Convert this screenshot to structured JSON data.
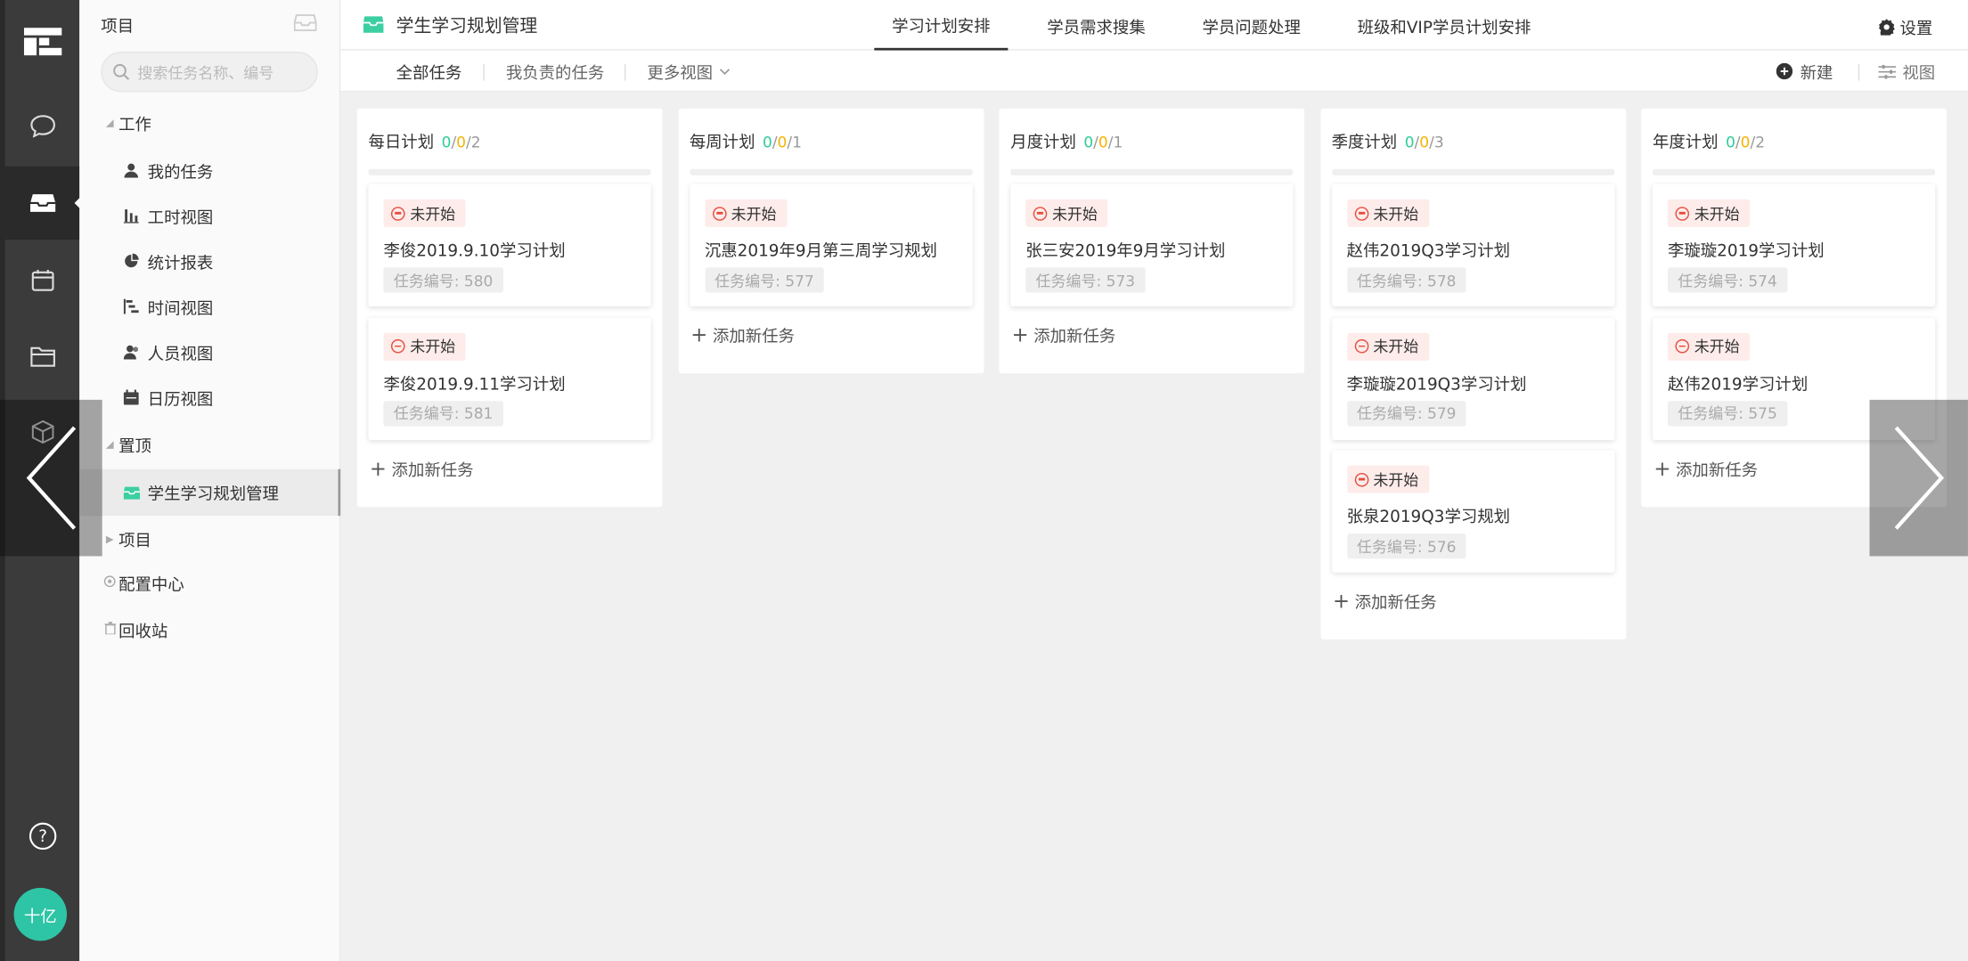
{
  "rail": {
    "avatar_label": "十亿",
    "items": [
      "dashboard-icon",
      "chat-icon",
      "inbox-icon",
      "calendar-icon",
      "folder-icon",
      "cube-icon"
    ],
    "help_icon": "question-circle-icon"
  },
  "sidebar": {
    "title": "项目",
    "search_placeholder": "搜索任务名称、编号",
    "groups": {
      "work": "工作",
      "pinned": "置顶",
      "projects": "项目"
    },
    "work_items": [
      {
        "label": "我的任务",
        "icon": "user-icon"
      },
      {
        "label": "工时视图",
        "icon": "bar-chart-icon"
      },
      {
        "label": "统计报表",
        "icon": "pie-chart-icon"
      },
      {
        "label": "时间视图",
        "icon": "gantt-icon"
      },
      {
        "label": "人员视图",
        "icon": "team-icon"
      },
      {
        "label": "日历视图",
        "icon": "calendar-icon"
      }
    ],
    "pinned_item": "学生学习规划管理",
    "config": "配置中心",
    "recycle": "回收站"
  },
  "header": {
    "project_name": "学生学习规划管理",
    "tabs": [
      "学习计划安排",
      "学员需求搜集",
      "学员问题处理",
      "班级和VIP学员计划安排"
    ],
    "active_tab": 0,
    "settings": "设置"
  },
  "subbar": {
    "tabs": [
      "全部任务",
      "我负责的任务",
      "更多视图"
    ],
    "new": "新建",
    "view": "视图"
  },
  "board": {
    "add_task": "添加新任务",
    "status_label": "未开始",
    "id_prefix": "任务编号: ",
    "columns": [
      {
        "name": "每日计划",
        "done": "0",
        "doing": "0",
        "total": "2",
        "cards": [
          {
            "title": "李俊2019.9.10学习计划",
            "id": "任务编号: 580"
          },
          {
            "title": "李俊2019.9.11学习计划",
            "id": "任务编号: 581"
          }
        ]
      },
      {
        "name": "每周计划",
        "done": "0",
        "doing": "0",
        "total": "1",
        "cards": [
          {
            "title": "沉惠2019年9月第三周学习规划",
            "id": "任务编号: 577"
          }
        ]
      },
      {
        "name": "月度计划",
        "done": "0",
        "doing": "0",
        "total": "1",
        "cards": [
          {
            "title": "张三安2019年9月学习计划",
            "id": "任务编号: 573"
          }
        ]
      },
      {
        "name": "季度计划",
        "done": "0",
        "doing": "0",
        "total": "3",
        "cards": [
          {
            "title": "赵伟2019Q3学习计划",
            "id": "任务编号: 578"
          },
          {
            "title": "李璇璇2019Q3学习计划",
            "id": "任务编号: 579"
          },
          {
            "title": "张泉2019Q3学习规划",
            "id": "任务编号: 576"
          }
        ]
      },
      {
        "name": "年度计划",
        "done": "0",
        "doing": "0",
        "total": "2",
        "cards": [
          {
            "title": "李璇璇2019学习计划",
            "id": "任务编号: 574"
          },
          {
            "title": "赵伟2019学习计划",
            "id": "任务编号: 575"
          }
        ]
      }
    ]
  },
  "colors": {
    "accent": "#2ecc9a",
    "warning": "#f5b400",
    "danger": "#e74c3c",
    "rail": "#3b3b3b"
  }
}
